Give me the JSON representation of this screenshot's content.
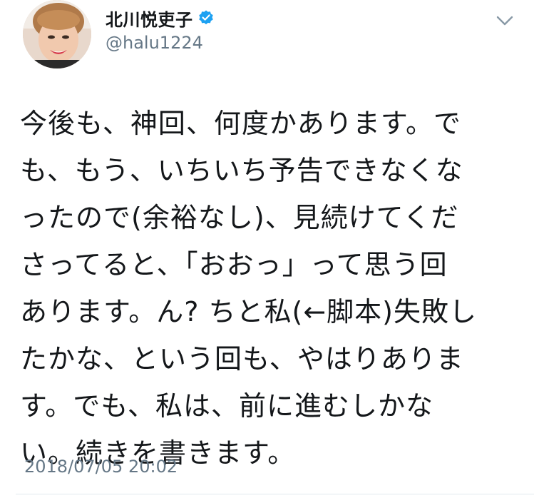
{
  "author": {
    "display_name": "北川悦吏子",
    "handle": "@halu1224",
    "verified": true
  },
  "icons": {
    "verified": "verified-badge-icon",
    "menu": "chevron-down-icon"
  },
  "colors": {
    "verified_blue": "#1da1f2",
    "secondary_text": "#657786",
    "primary_text": "#14171a"
  },
  "tweet": {
    "lines": [
      "今後も、神回、何度かあります。で",
      "も、もう、いちいち予告できなくな",
      "ったので(余裕なし)、見続けてくだ",
      "さってると、「おおっ」って思う回",
      "あります。ん? ちと私(←脚本)失敗し",
      "たかな、という回も、やはりありま",
      "す。でも、私は、前に進むしかな",
      "い。続きを書きます。"
    ],
    "timestamp": "2018/07/05 20:02"
  }
}
